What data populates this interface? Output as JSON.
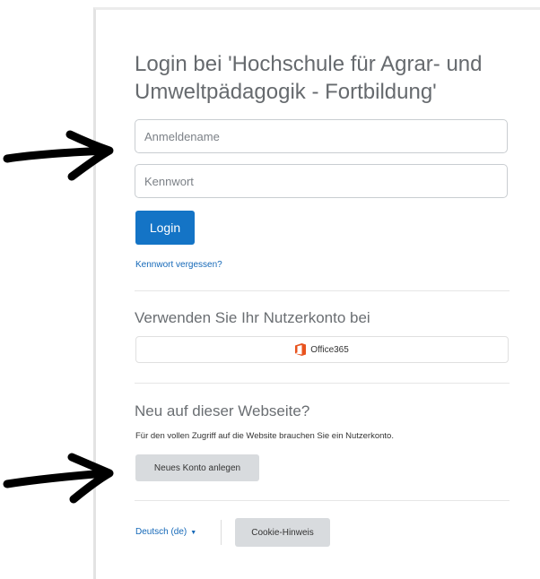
{
  "login": {
    "title": "Login bei 'Hochschule für Agrar- und Umweltpädagogik - Fortbildung'",
    "username_placeholder": "Anmeldename",
    "password_placeholder": "Kennwort",
    "login_button": "Login",
    "forgot_link": "Kennwort vergessen?"
  },
  "oauth": {
    "heading": "Verwenden Sie Ihr Nutzerkonto bei",
    "provider_label": "Office365",
    "provider_icon": "office365-icon",
    "provider_color": "#e8531e"
  },
  "signup": {
    "heading": "Neu auf dieser Webseite?",
    "info": "Für den vollen Zugriff auf die Website brauchen Sie ein Nutzerkonto.",
    "button": "Neues Konto anlegen"
  },
  "footer": {
    "language": "Deutsch (de)",
    "cookie_button": "Cookie-Hinweis"
  },
  "colors": {
    "primary": "#1474c6",
    "link": "#1468b8",
    "secondary_button": "#d8dbde",
    "annotation_arrow": "#000000"
  }
}
